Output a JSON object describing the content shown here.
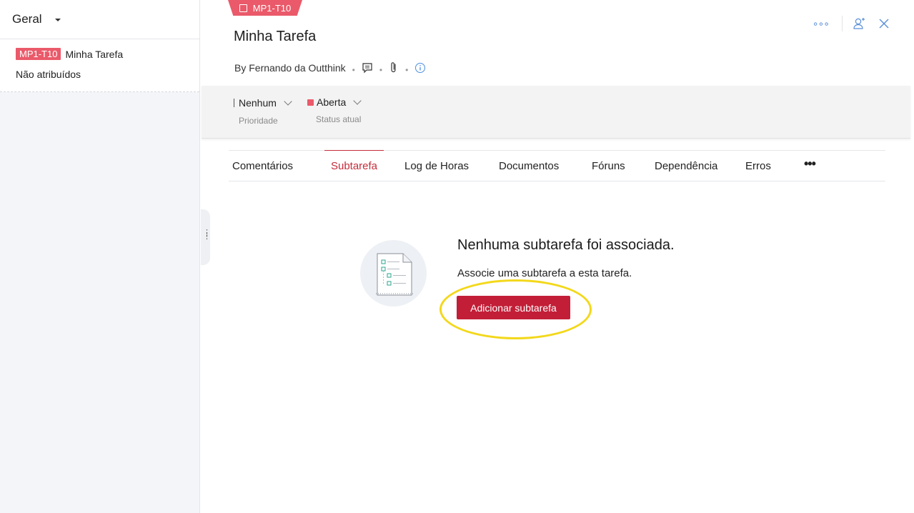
{
  "sidebar": {
    "title": "Geral",
    "item": {
      "tag": "MP1-T10",
      "name": "Minha Tarefa",
      "assignee": "Não atribuídos"
    }
  },
  "header": {
    "badge": "MP1-T10",
    "title": "Minha Tarefa",
    "byline": "By Fernando da Outthink"
  },
  "fields": {
    "priority": {
      "value": "Nenhum",
      "label": "Prioridade"
    },
    "status": {
      "value": "Aberta",
      "label": "Status atual",
      "color": "#ea5a6a"
    }
  },
  "tabs": [
    {
      "label": "Comentários"
    },
    {
      "label": "Subtarefa",
      "active": true
    },
    {
      "label": "Log de Horas"
    },
    {
      "label": "Documentos"
    },
    {
      "label": "Fóruns"
    },
    {
      "label": "Dependência"
    },
    {
      "label": "Erros"
    }
  ],
  "empty_state": {
    "title": "Nenhuma subtarefa foi associada.",
    "subtitle": "Associe uma subtarefa a esta tarefa.",
    "button": "Adicionar subtarefa"
  },
  "colors": {
    "accent": "#c31e37",
    "tag": "#ea5a6a",
    "link_icon": "#5a8fd8",
    "highlight": "#f3d81b"
  }
}
